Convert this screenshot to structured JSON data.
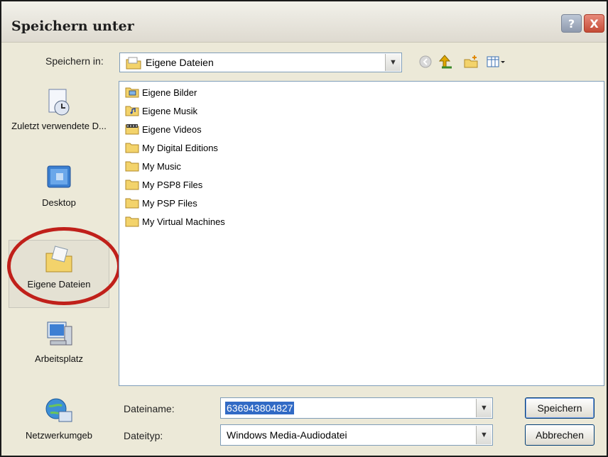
{
  "dialog": {
    "title": "Speichern unter",
    "help_button": "?",
    "close_button": "X"
  },
  "toolbar": {
    "save_in_label": "Speichern in:",
    "save_in_value": "Eigene Dateien",
    "icons": [
      "back-icon",
      "up-folder-icon",
      "new-folder-icon",
      "view-menu-icon"
    ]
  },
  "places": [
    {
      "label": "Zuletzt verwendete D...",
      "icon": "recent-documents-icon"
    },
    {
      "label": "Desktop",
      "icon": "desktop-icon"
    },
    {
      "label": "Eigene Dateien",
      "icon": "my-documents-icon"
    },
    {
      "label": "Arbeitsplatz",
      "icon": "my-computer-icon"
    },
    {
      "label": "Netzwerkumgeb",
      "icon": "network-icon"
    }
  ],
  "files": [
    {
      "name": "Eigene Bilder",
      "icon": "pictures-folder-icon"
    },
    {
      "name": "Eigene Musik",
      "icon": "music-folder-icon"
    },
    {
      "name": "Eigene Videos",
      "icon": "videos-folder-icon"
    },
    {
      "name": "My Digital Editions",
      "icon": "folder-icon"
    },
    {
      "name": "My Music",
      "icon": "folder-icon"
    },
    {
      "name": "My PSP8 Files",
      "icon": "folder-icon"
    },
    {
      "name": "My PSP Files",
      "icon": "folder-icon"
    },
    {
      "name": "My Virtual Machines",
      "icon": "folder-icon"
    }
  ],
  "form": {
    "filename_label": "Dateiname:",
    "filename_value": "636943804827",
    "filetype_label": "Dateityp:",
    "filetype_value": "Windows Media-Audiodatei"
  },
  "buttons": {
    "save": "Speichern",
    "cancel": "Abbrechen"
  },
  "colors": {
    "highlight_ring": "#c0201a",
    "folder": "#f3d36b",
    "close": "#c44b36"
  }
}
